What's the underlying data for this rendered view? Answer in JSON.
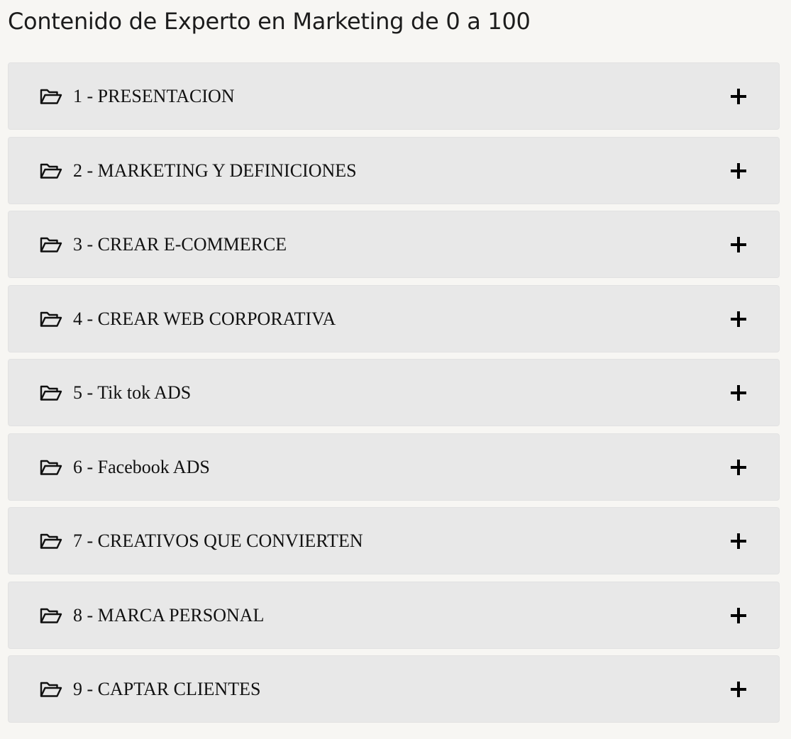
{
  "page": {
    "title": "Contenido de Experto en Marketing de 0 a 100"
  },
  "modules": [
    {
      "label": "1 - PRESENTACION",
      "icon": "folder-open-icon",
      "toggle_icon": "plus-icon"
    },
    {
      "label": "2 - MARKETING Y DEFINICIONES",
      "icon": "folder-open-icon",
      "toggle_icon": "plus-icon"
    },
    {
      "label": "3 - CREAR E-COMMERCE",
      "icon": "folder-open-icon",
      "toggle_icon": "plus-icon"
    },
    {
      "label": "4 - CREAR WEB CORPORATIVA",
      "icon": "folder-open-icon",
      "toggle_icon": "plus-icon"
    },
    {
      "label": "5 - Tik tok ADS",
      "icon": "folder-open-icon",
      "toggle_icon": "plus-icon"
    },
    {
      "label": "6 - Facebook ADS",
      "icon": "folder-open-icon",
      "toggle_icon": "plus-icon"
    },
    {
      "label": "7 - CREATIVOS QUE CONVIERTEN",
      "icon": "folder-open-icon",
      "toggle_icon": "plus-icon"
    },
    {
      "label": "8 - MARCA PERSONAL",
      "icon": "folder-open-icon",
      "toggle_icon": "plus-icon"
    },
    {
      "label": "9 - CAPTAR CLIENTES",
      "icon": "folder-open-icon",
      "toggle_icon": "plus-icon"
    }
  ],
  "colors": {
    "background": "#f7f6f3",
    "item_background": "#e8e8e8",
    "text": "#111111"
  }
}
